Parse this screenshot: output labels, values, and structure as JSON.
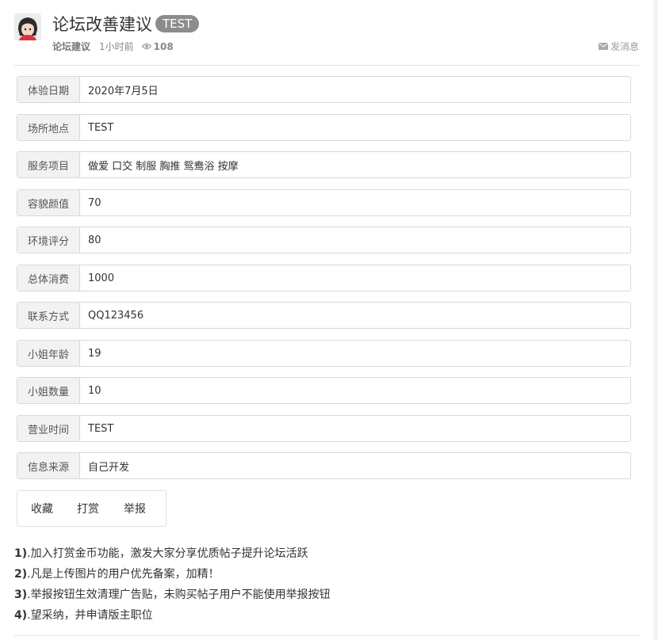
{
  "post": {
    "title": "论坛改善建议",
    "badge": "TEST",
    "forum": "论坛建议",
    "time": "1小时前",
    "views": "108",
    "message_label": "发消息"
  },
  "fields": [
    {
      "label": "体验日期",
      "value": "2020年7月5日"
    },
    {
      "label": "场所地点",
      "value": "TEST"
    },
    {
      "label": "服务项目",
      "value": "做爱 口交 制服 胸推 鸳鸯浴 按摩"
    },
    {
      "label": "容貌颜值",
      "value": "70"
    },
    {
      "label": "环境评分",
      "value": "80"
    },
    {
      "label": "总体消费",
      "value": "1000"
    },
    {
      "label": "联系方式",
      "value": "QQ123456"
    },
    {
      "label": "小姐年龄",
      "value": "19"
    },
    {
      "label": "小姐数量",
      "value": "10"
    },
    {
      "label": "营业时间",
      "value": "TEST"
    },
    {
      "label": "信息来源",
      "value": "自己开发"
    }
  ],
  "actions": {
    "favorite": "收藏",
    "reward": "打赏",
    "report": "举报"
  },
  "content": [
    {
      "num": "1)",
      "text": ".加入打赏金币功能，激发大家分享优质帖子提升论坛活跃"
    },
    {
      "num": "2)",
      "text": ".凡是上传图片的用户优先备案，加精！"
    },
    {
      "num": "3)",
      "text": ".举报按钮生效清理广告贴，未购买帖子用户不能使用举报按钮"
    },
    {
      "num": "4)",
      "text": ".望采纳，并申请版主职位"
    }
  ],
  "icons": {
    "views": "eye-icon",
    "message": "envelope-icon",
    "avatar": "user-avatar"
  }
}
